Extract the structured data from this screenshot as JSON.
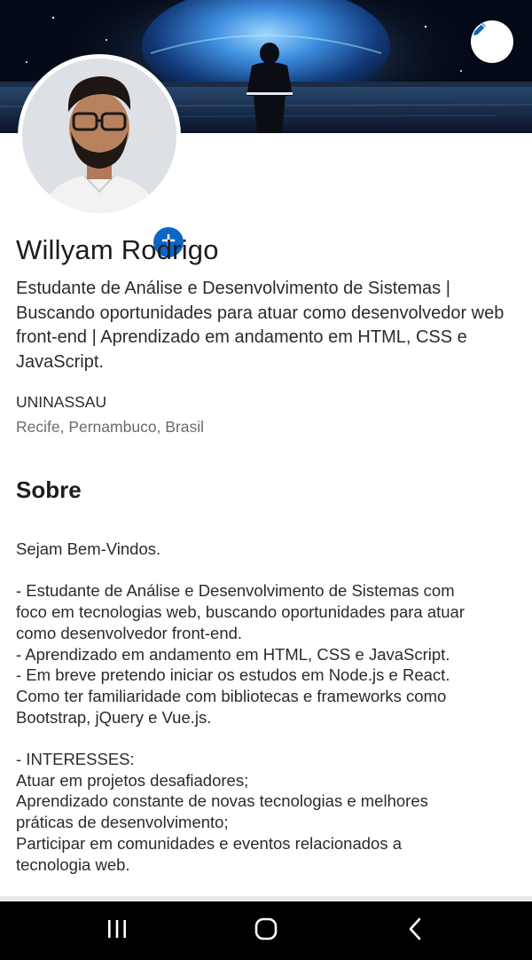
{
  "profile": {
    "name": "Willyam Rodrigo",
    "headline": "Estudante de Análise e Desenvolvimento de Sistemas | Buscando oportunidades para atuar como desenvolvedor web front-end | Aprendizado em andamento em HTML, CSS e JavaScript.",
    "organization": "UNINASSAU",
    "location": "Recife, Pernambuco, Brasil"
  },
  "about": {
    "title": "Sobre",
    "lines": [
      "Sejam Bem-Vindos.",
      "",
      "- Estudante de Análise e Desenvolvimento de Sistemas com",
      "foco em tecnologias web, buscando oportunidades para atuar",
      "como desenvolvedor front-end.",
      "- Aprendizado em andamento em HTML, CSS e JavaScript.",
      "- Em breve pretendo iniciar os estudos em Node.js e React.",
      "Como ter familiaridade com bibliotecas e frameworks como",
      "Bootstrap, jQuery e Vue.js.",
      "",
      "- INTERESSES:",
      "Atuar em projetos desafiadores;",
      "Aprendizado constante de novas tecnologias e melhores",
      "práticas de desenvolvimento;",
      "Participar em comunidades e eventos relacionados a",
      "tecnologia web."
    ]
  },
  "icons": {
    "edit": "pencil-icon",
    "add_photo": "plus-icon",
    "recents": "recents-icon",
    "home": "home-icon",
    "back": "back-icon"
  },
  "colors": {
    "accent": "#0a66c2",
    "navbar": "#000000",
    "text_primary": "#1d1d1d",
    "text_secondary": "#6b6b6b"
  }
}
